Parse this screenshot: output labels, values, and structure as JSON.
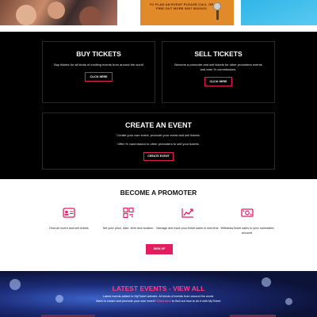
{
  "hero": {
    "banner_text": "TO PLAN AN EVENT PLEASE CALL OR FIND OUT MORE 0807 8823222"
  },
  "buy": {
    "title": "BUY TICKETS",
    "text": "Buy tickets for all kinds of exciting events from around the world",
    "button": "CLICK HERE"
  },
  "sell": {
    "title": "SELL TICKETS",
    "text": "Become a promoter and sell tickets for other promoters events and earn % commissions.",
    "button": "CLICK HERE"
  },
  "create": {
    "title": "CREATE AN EVENT",
    "line1": "Create your own event, promote your event and sell tickets.",
    "line2": "Offer % commission to other promoters to sell your tickets.",
    "button": "CREATE EVENT"
  },
  "promoter": {
    "title": "BECOME A PROMOTER",
    "features": [
      {
        "icon": "id-card-icon",
        "text": "Host an event and sell tickets"
      },
      {
        "icon": "qr-code-icon",
        "text": "Set your price, date, time and location."
      },
      {
        "icon": "trend-chart-icon",
        "text": "Manage and track your ticket sales in real time."
      },
      {
        "icon": "cash-icon",
        "text": "Withdraw ticket sales to your nominated account."
      }
    ],
    "button": "SIGN UP"
  },
  "events": {
    "title": "LATEST EVENTS - VIEW ALL",
    "line1": "Latest events added to MyTicket website. All kinds of events from around the world.",
    "line2_pre": "Want to create and promote your own event? ",
    "line2_link": "Click here",
    "line2_post": " to find out how to do it with MyTicket."
  },
  "colors": {
    "accent": "#e21e5f",
    "events_title": "#ff3f8a",
    "dark_bg": "#000000"
  }
}
